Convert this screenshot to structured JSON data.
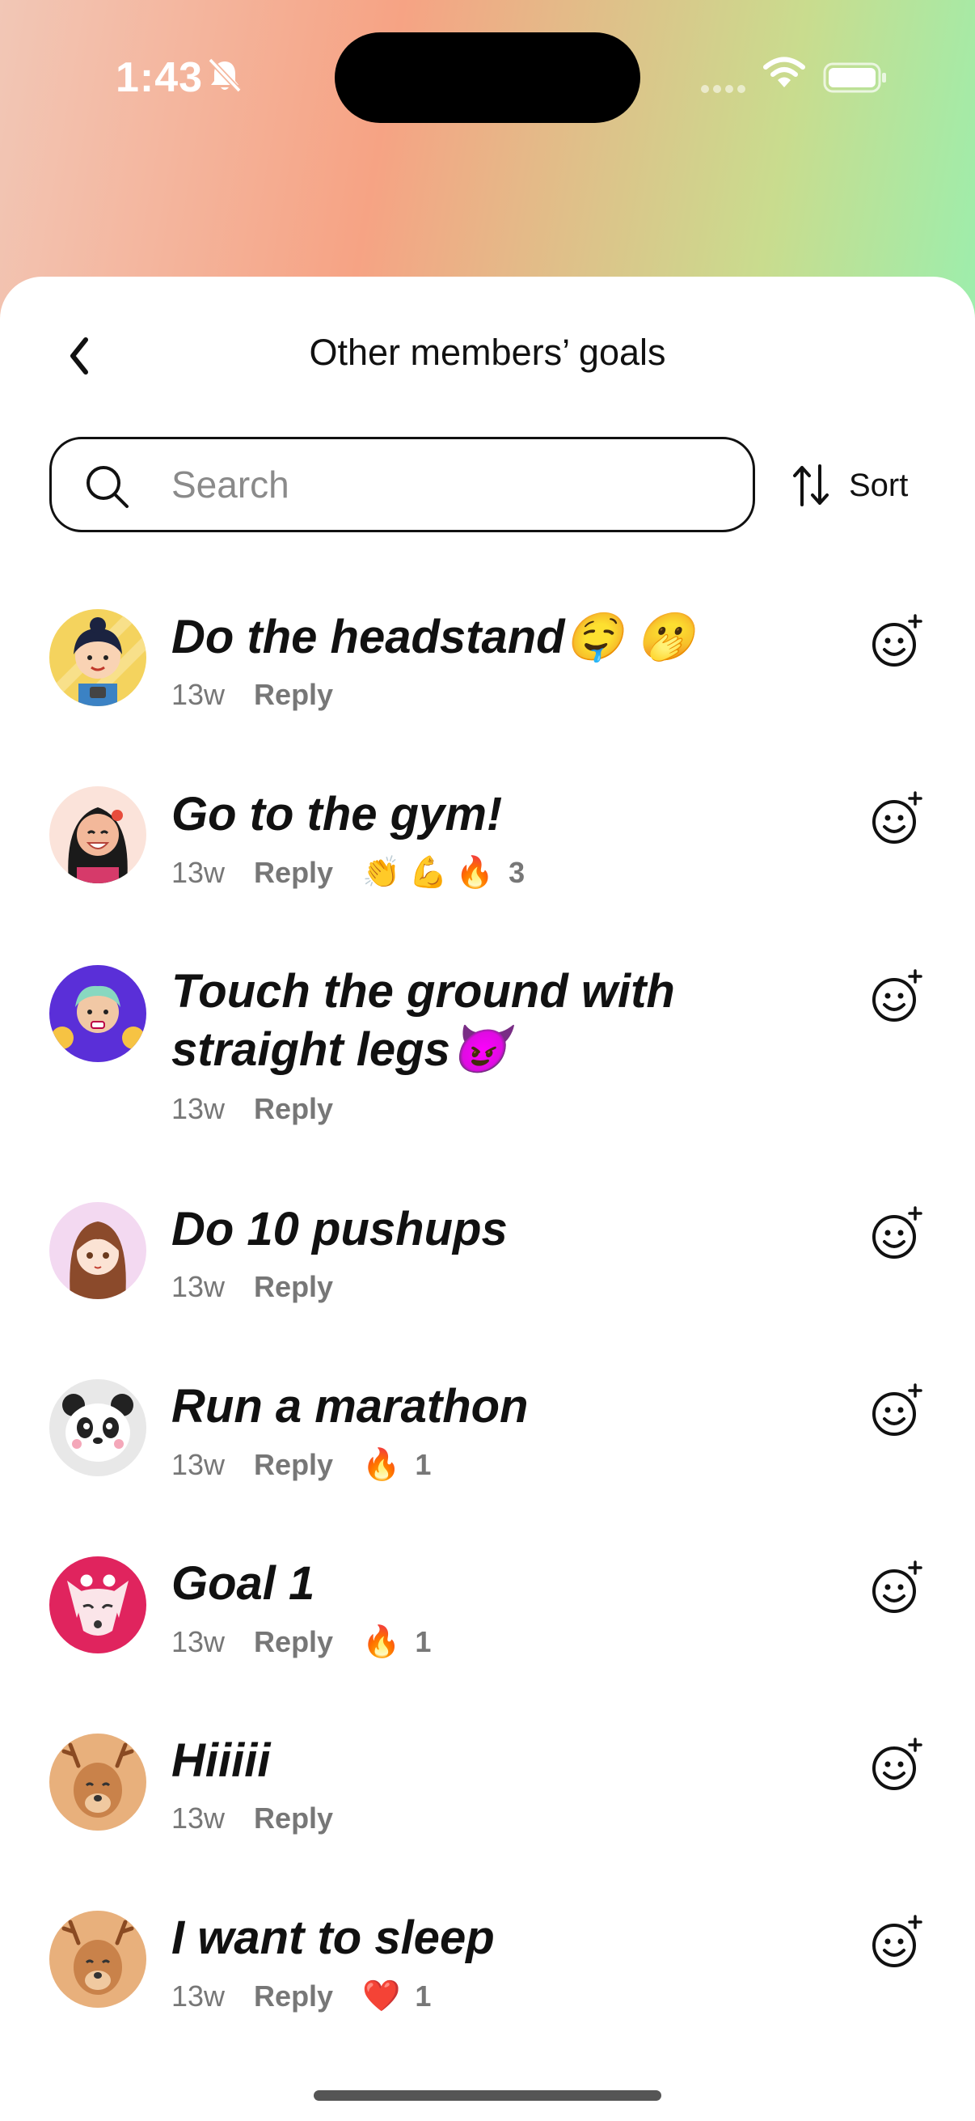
{
  "status": {
    "time": "1:43"
  },
  "header": {
    "title": "Other members’ goals"
  },
  "search": {
    "placeholder": "Search"
  },
  "sort": {
    "label": "Sort"
  },
  "goals": [
    {
      "text": "Do the headstand🤤 🫢",
      "age": "13w",
      "reply": "Reply",
      "reactions": "",
      "count": ""
    },
    {
      "text": "Go to the gym!",
      "age": "13w",
      "reply": "Reply",
      "reactions": "👏 💪 🔥",
      "count": "3"
    },
    {
      "text": "Touch the ground with straight legs😈",
      "age": "13w",
      "reply": "Reply",
      "reactions": "",
      "count": ""
    },
    {
      "text": "Do 10 pushups",
      "age": "13w",
      "reply": "Reply",
      "reactions": "",
      "count": ""
    },
    {
      "text": "Run a marathon",
      "age": "13w",
      "reply": "Reply",
      "reactions": "🔥",
      "count": "1"
    },
    {
      "text": "Goal 1",
      "age": "13w",
      "reply": "Reply",
      "reactions": "🔥",
      "count": "1"
    },
    {
      "text": "Hiiiii",
      "age": "13w",
      "reply": "Reply",
      "reactions": "",
      "count": ""
    },
    {
      "text": "I want to sleep",
      "age": "13w",
      "reply": "Reply",
      "reactions": "❤️",
      "count": "1"
    }
  ],
  "icons": {
    "back": "chevron-left-icon",
    "search": "search-icon",
    "sort": "sort-arrows-icon",
    "react": "add-reaction-icon"
  }
}
